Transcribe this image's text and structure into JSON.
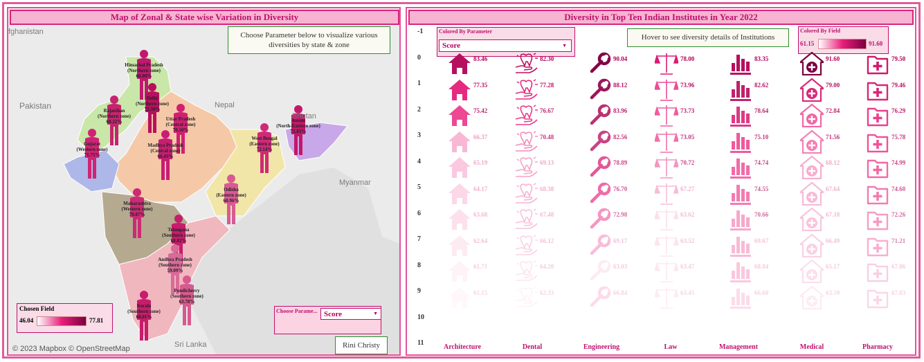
{
  "left": {
    "title": "Map of Zonal  & State wise Variation in Diversity",
    "instruction": "Choose Parameter below to visualize various diversities by state & zone",
    "map_labels": {
      "afghanistan": "fghanistan",
      "pakistan": "Pakistan",
      "nepal": "Nepal",
      "bhutan": "Bhutan",
      "myanmar": "Myanmar",
      "sri_lanka": "Sri Lanka"
    },
    "states": [
      {
        "name": "Himachal Pradesh",
        "zone": "(Northern zone)",
        "value": "66.00%"
      },
      {
        "name": "Delhi",
        "zone": "(Northern zone)",
        "value": "72.30%"
      },
      {
        "name": "Rajasthan",
        "zone": "(Northern zone)",
        "value": "68.22%"
      },
      {
        "name": "Uttar Pradesh",
        "zone": "(Central zone)",
        "value": "70.10%"
      },
      {
        "name": "Assam",
        "zone": "(North-Eastern zone)",
        "value": "72.83%"
      },
      {
        "name": "West Bengal",
        "zone": "(Eastern zone)",
        "value": "72.14%"
      },
      {
        "name": "Gujarat",
        "zone": "(Western zone)",
        "value": "71.75%"
      },
      {
        "name": "Madhya Pradesh",
        "zone": "(Central zone)",
        "value": "66.43%"
      },
      {
        "name": "Odisha",
        "zone": "(Eastern zone)",
        "value": "60.96%"
      },
      {
        "name": "Maharashtra",
        "zone": "(Western zone)",
        "value": "70.87%"
      },
      {
        "name": "Telangana",
        "zone": "(Southern zone)",
        "value": "68.82%"
      },
      {
        "name": "Andhra Pradesh",
        "zone": "(Southern zone)",
        "value": "59.09%"
      },
      {
        "name": "Pondicherry",
        "zone": "(Southern zone)",
        "value": "63.78%"
      },
      {
        "name": "Kerala",
        "zone": "(Southern zone)",
        "value": "68.01%"
      }
    ],
    "legend": {
      "title": "Chosen Field",
      "min": "46.04",
      "max": "77.81"
    },
    "param": {
      "label": "Choose Parame...",
      "value": "Score"
    },
    "credit": "© 2023 Mapbox  © OpenStreetMap",
    "author": "Rini Christy"
  },
  "right": {
    "title": "Diversity in Top Ten Indian Institutes in Year 2022",
    "colored_by_param_label": "Colored By Parameter",
    "param_value": "Score",
    "hover_note": "Hover to see diversity details of Institutions",
    "colored_by_field_label": "Colored By Field",
    "field_min": "61.15",
    "field_max": "91.60",
    "row_labels": [
      "-1",
      "0",
      "1",
      "2",
      "3",
      "4",
      "5",
      "6",
      "7",
      "8",
      "9",
      "10",
      "11"
    ],
    "columns": [
      "Architecture",
      "Dental",
      "Engineering",
      "Law",
      "Management",
      "Medical",
      "Pharmacy"
    ],
    "icons": [
      "home-icon",
      "tooth-hand-icon",
      "wrench-icon",
      "scales-icon",
      "bar-chart-icon",
      "hospital-icon",
      "medical-folder-icon"
    ],
    "values": [
      [
        "83.46",
        "77.35",
        "75.42",
        "66.37",
        "65.19",
        "64.17",
        "63.68",
        "62.64",
        "61.71",
        "61.15"
      ],
      [
        "82.30",
        "77.28",
        "76.67",
        "70.48",
        "69.13",
        "68.38",
        "67.48",
        "66.12",
        "64.20",
        "62.33"
      ],
      [
        "90.04",
        "88.12",
        "83.96",
        "82.56",
        "78.89",
        "76.70",
        "72.98",
        "69.17",
        "63.03",
        "66.84"
      ],
      [
        "78.00",
        "73.96",
        "73.73",
        "73.05",
        "70.72",
        "67.27",
        "63.62",
        "63.52",
        "63.47",
        "63.45"
      ],
      [
        "83.35",
        "82.62",
        "78.64",
        "75.10",
        "74.74",
        "74.55",
        "70.66",
        "69.67",
        "68.84",
        "66.60"
      ],
      [
        "91.60",
        "79.00",
        "72.84",
        "71.56",
        "68.12",
        "67.64",
        "67.18",
        "66.49",
        "65.17",
        "63.59"
      ],
      [
        "79.50",
        "79.46",
        "76.29",
        "75.78",
        "74.99",
        "74.60",
        "72.26",
        "71.21",
        "67.86",
        "67.83"
      ]
    ]
  }
}
